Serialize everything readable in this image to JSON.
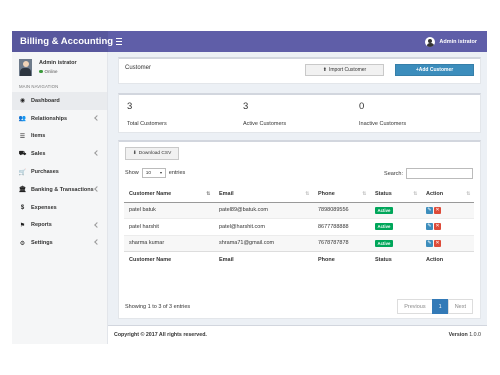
{
  "app": {
    "title": "Billing & Accounting"
  },
  "topbar": {
    "user_name": "Admin istrator"
  },
  "sidebar": {
    "user_name": "Admin istrator",
    "status": "Online",
    "nav_header": "MAIN NAVIGATION",
    "items": [
      {
        "label": "Dashboard",
        "icon": "dashboard-icon",
        "glyph": "◉"
      },
      {
        "label": "Relationships",
        "icon": "users-icon",
        "glyph": "👥"
      },
      {
        "label": "Items",
        "icon": "list-icon",
        "glyph": "☰"
      },
      {
        "label": "Sales",
        "icon": "truck-icon",
        "glyph": "⛟"
      },
      {
        "label": "Purchases",
        "icon": "cart-icon",
        "glyph": "🛒"
      },
      {
        "label": "Banking & Transactions",
        "icon": "bank-icon",
        "glyph": "🏛"
      },
      {
        "label": "Expenses",
        "icon": "dollar-icon",
        "glyph": "$"
      },
      {
        "label": "Reports",
        "icon": "reports-icon",
        "glyph": "⚑"
      },
      {
        "label": "Settings",
        "icon": "gear-icon",
        "glyph": "⚙"
      }
    ]
  },
  "header_box": {
    "title": "Customer",
    "import_label": "Import Customer",
    "add_label": "+Add Customer"
  },
  "stats": [
    {
      "value": "3",
      "label": "Total Customers"
    },
    {
      "value": "3",
      "label": "Active Customers"
    },
    {
      "value": "0",
      "label": "Inactive Customers"
    }
  ],
  "table_box": {
    "csv_label": "Download CSV",
    "show_label": "Show",
    "entries_value": "10",
    "entries_label": "entries",
    "search_label": "Search:",
    "search_value": "",
    "columns": [
      "Customer Name",
      "Email",
      "Phone",
      "Status",
      "Action"
    ],
    "rows": [
      {
        "name": "patel batuk",
        "email": "patel89@batuk.com",
        "phone": "7898089556",
        "status": "Active"
      },
      {
        "name": "patel harshit",
        "email": "patel@harshit.com",
        "phone": "8677788888",
        "status": "Active"
      },
      {
        "name": "sharma kumar",
        "email": "shrama71@gmail.com",
        "phone": "7678787878",
        "status": "Active"
      }
    ],
    "info": "Showing 1 to 3 of 3 entries",
    "pager": {
      "prev": "Previous",
      "page": "1",
      "next": "Next"
    }
  },
  "footer": {
    "copyright": "Copyright © 2017 All rights reserved.",
    "version_label": "Version",
    "version_value": "1.0.0"
  },
  "colors": {
    "topbar": "#5f5ea8",
    "primary_button": "#3c8dbc",
    "status_active": "#00a65a",
    "delete_button": "#dd4b39"
  }
}
